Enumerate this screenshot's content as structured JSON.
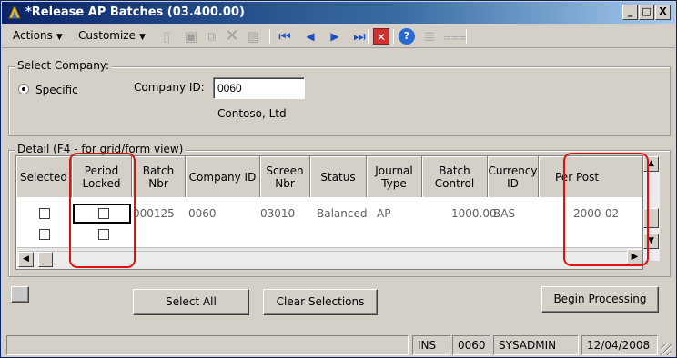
{
  "window": {
    "title": "*Release AP Batches (03.400.00)",
    "controls": {
      "minimize": "_",
      "maximize": "□",
      "close": "X"
    }
  },
  "menubar": {
    "actions": "Actions",
    "customize": "Customize"
  },
  "toolbar_icons": [
    "new-icon",
    "save-icon",
    "copy-icon",
    "delete-icon",
    "print-icon",
    "first-icon",
    "previous-icon",
    "next-icon",
    "last-icon",
    "close-icon",
    "help-icon",
    "note-icon",
    "attachment-icon"
  ],
  "select_company": {
    "legend": "Select Company:",
    "specific_label": "Specific",
    "company_id_label": "Company ID:",
    "company_id_value": "0060",
    "company_name": "Contoso, Ltd"
  },
  "detail": {
    "legend": "Detail (F4 - for grid/form view)",
    "columns": [
      {
        "key": "selected",
        "label": "Selected"
      },
      {
        "key": "period_locked",
        "label": "Period Locked"
      },
      {
        "key": "batch_nbr",
        "label": "Batch Nbr"
      },
      {
        "key": "company_id",
        "label": "Company ID"
      },
      {
        "key": "screen_nbr",
        "label": "Screen Nbr"
      },
      {
        "key": "status",
        "label": "Status"
      },
      {
        "key": "journal_type",
        "label": "Journal Type"
      },
      {
        "key": "batch_control",
        "label": "Batch Control"
      },
      {
        "key": "currency_id",
        "label": "Currency ID"
      },
      {
        "key": "per_post",
        "label": "Per Post"
      }
    ],
    "rows": [
      {
        "batch_nbr": "000125",
        "company_id": "0060",
        "screen_nbr": "03010",
        "status": "Balanced",
        "journal_type": "AP",
        "batch_control": "1000.00",
        "currency_id": "BAS",
        "per_post": "2000-02"
      }
    ]
  },
  "buttons": {
    "select_all": "Select All",
    "clear_selections": "Clear Selections",
    "begin_processing": "Begin Processing"
  },
  "statusbar": {
    "mode": "INS",
    "company": "0060",
    "user": "SYSADMIN",
    "date": "12/04/2008"
  },
  "colors": {
    "titlebar": "#0a246a",
    "highlight": "#e01010",
    "face": "#d4d0c8"
  }
}
